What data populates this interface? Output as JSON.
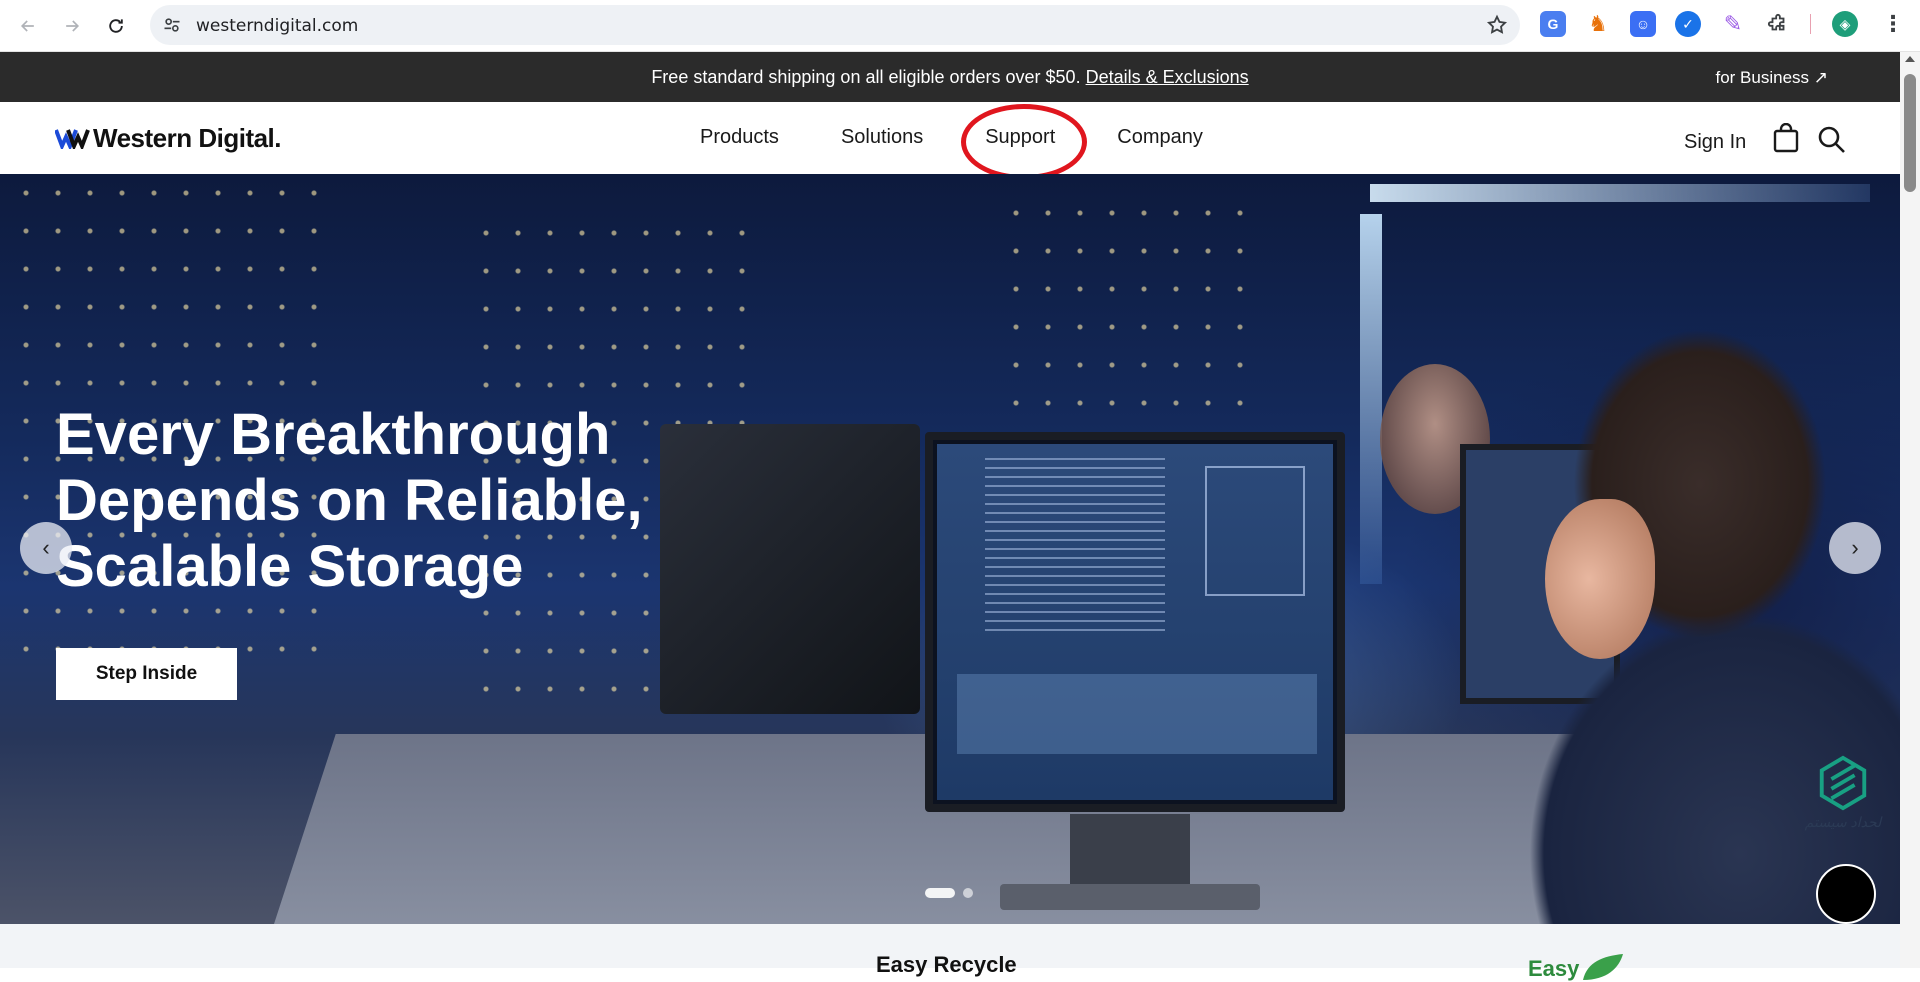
{
  "browser": {
    "url": "westerndigital.com",
    "extensions": [
      "translate-icon",
      "puppet-icon",
      "robot-icon",
      "check-icon",
      "pen-icon",
      "puzzle-icon",
      "avatar-icon",
      "menu-icon"
    ]
  },
  "promo": {
    "text": "Free standard shipping on all eligible orders over $50.",
    "link": "Details & Exclusions",
    "for_business": "for Business ↗"
  },
  "header": {
    "logo_text": "Western Digital.",
    "nav": {
      "products": "Products",
      "solutions": "Solutions",
      "support": "Support",
      "company": "Company"
    },
    "sign_in": "Sign In",
    "highlight_color": "#e0161e"
  },
  "hero": {
    "title_line1": "Every Breakthrough",
    "title_line2": "Depends on Reliable,",
    "title_line3": "Scalable Storage",
    "cta": "Step Inside",
    "prev": "‹",
    "next": "›",
    "watermark_text": "لحداد سیستم"
  },
  "below": {
    "title": "Easy Recycle",
    "easy_text": "Easy"
  }
}
